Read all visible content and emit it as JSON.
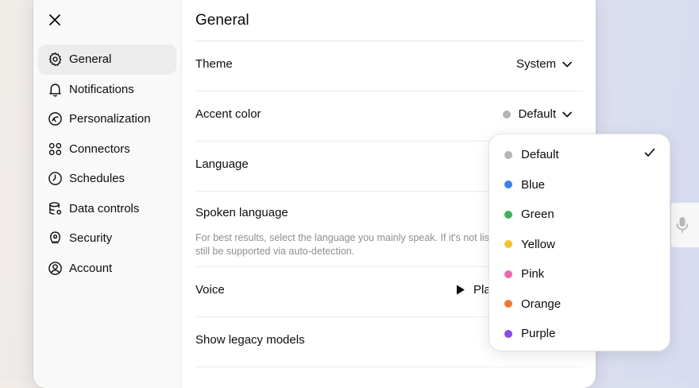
{
  "sidebar": {
    "items": [
      {
        "label": "General",
        "icon": "gear-icon",
        "active": true
      },
      {
        "label": "Notifications",
        "icon": "bell-icon"
      },
      {
        "label": "Personalization",
        "icon": "personalization-icon"
      },
      {
        "label": "Connectors",
        "icon": "connectors-icon"
      },
      {
        "label": "Schedules",
        "icon": "clock-icon"
      },
      {
        "label": "Data controls",
        "icon": "database-icon"
      },
      {
        "label": "Security",
        "icon": "security-icon"
      },
      {
        "label": "Account",
        "icon": "user-circle-icon"
      }
    ]
  },
  "general": {
    "title": "General",
    "theme": {
      "label": "Theme",
      "value": "System"
    },
    "accent": {
      "label": "Accent color",
      "value": "Default",
      "color": "#b4b4b4"
    },
    "language": {
      "label": "Language"
    },
    "spoken": {
      "label": "Spoken language",
      "hint": "For best results, select the language you mainly speak. If it's not listed, it may still be supported via auto-detection.",
      "hint_visible_line1": "For best results, select the language you mainly speak. If it's not list",
      "hint_visible_line2": "still be supported via auto-detection."
    },
    "voice": {
      "label": "Voice",
      "play_label": "Pla"
    },
    "legacy": {
      "label": "Show legacy models"
    }
  },
  "accent_menu": {
    "selected": "Default",
    "options": [
      {
        "label": "Default",
        "color": "#b4b4b4"
      },
      {
        "label": "Blue",
        "color": "#3b82e8"
      },
      {
        "label": "Green",
        "color": "#45b05a"
      },
      {
        "label": "Yellow",
        "color": "#f2c230"
      },
      {
        "label": "Pink",
        "color": "#ea6bb0"
      },
      {
        "label": "Orange",
        "color": "#ec7a32"
      },
      {
        "label": "Purple",
        "color": "#8a4be2"
      }
    ]
  }
}
